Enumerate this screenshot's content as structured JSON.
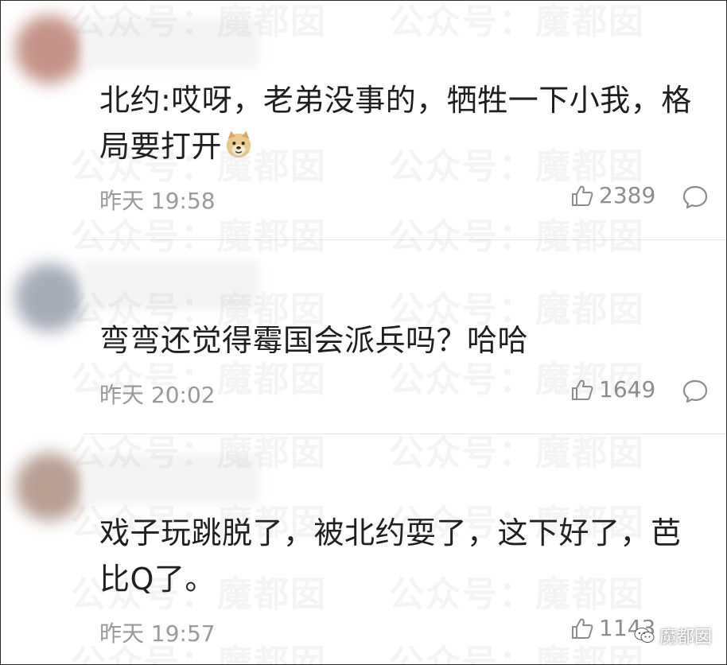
{
  "comments": [
    {
      "text": "北约:哎呀，老弟没事的，牺牲一下小我，格局要打开",
      "emoji": "doge-emoji",
      "time": "昨天 19:58",
      "likes": "2389"
    },
    {
      "text": "弯弯还觉得霉国会派兵吗？哈哈",
      "time": "昨天 20:02",
      "likes": "1649"
    },
    {
      "text": "戏子玩跳脱了，被北约耍了，这下好了，芭比Q了。",
      "time": "昨天 19:57",
      "likes": "1143"
    }
  ],
  "watermark": "公众号：魔都囡",
  "brand": "魔都囡",
  "colors": {
    "text": "#1f1f1f",
    "meta": "#9a9a9a",
    "divider": "#e6e6e6"
  }
}
